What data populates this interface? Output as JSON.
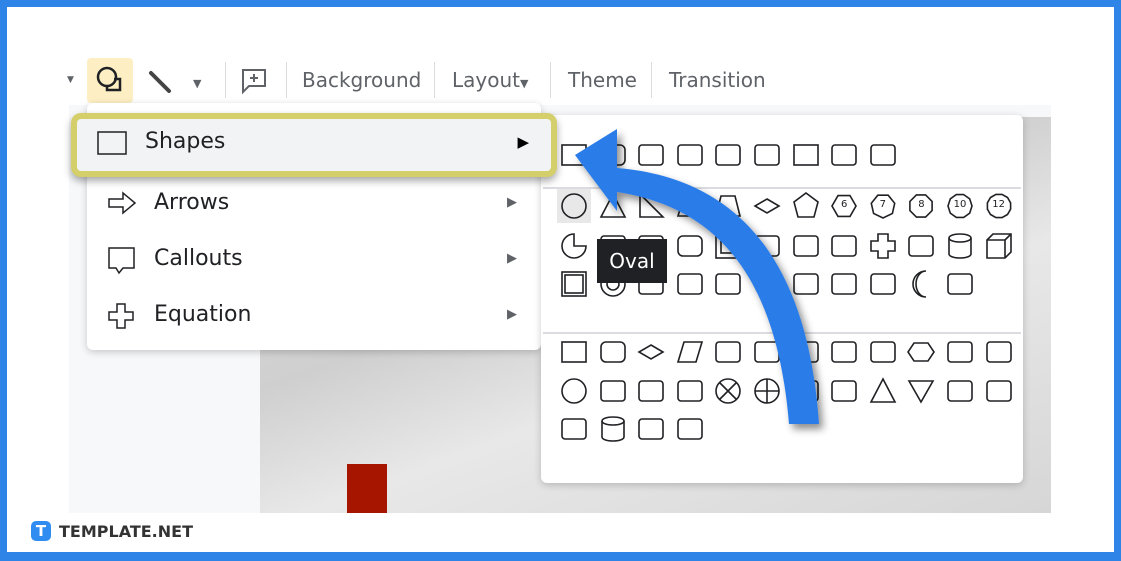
{
  "toolbar": {
    "background": "Background",
    "layout": "Layout",
    "theme": "Theme",
    "transition": "Transition"
  },
  "menu": {
    "items": [
      {
        "label": "Shapes",
        "icon": "square-icon"
      },
      {
        "label": "Arrows",
        "icon": "arrow-right-icon"
      },
      {
        "label": "Callouts",
        "icon": "callout-icon"
      },
      {
        "label": "Equation",
        "icon": "plus-icon"
      }
    ],
    "submenu_arrow": "▶"
  },
  "submenu": {
    "rows": [
      [
        "rect",
        "round-rect",
        "snip-rect",
        "round-top",
        "snip-corner",
        "round-top",
        "rect",
        "round-top",
        "round-corner"
      ],
      [
        "oval",
        "triangle",
        "right-triangle",
        "parallelogram",
        "trapezoid",
        "diamond",
        "pentagon",
        "hexagon-6",
        "heptagon-7",
        "octagon-8",
        "decagon-10",
        "dodecagon-12"
      ],
      [
        "pie",
        "chord",
        "teardrop",
        "round-rect",
        "frame",
        "half-frame",
        "l-shape",
        "diagonal-stripe",
        "cross",
        "octagon-plaque",
        "can",
        "cube"
      ],
      [
        "bevel",
        "donut",
        "no-symbol",
        "block-arc",
        "folded-corner",
        "smiley",
        "heart",
        "lightning",
        "sun",
        "moon",
        "cloud"
      ],
      [
        "rect",
        "round-rect",
        "diamond",
        "parallelogram",
        "predefined",
        "internal-storage",
        "document",
        "multidoc",
        "terminator",
        "hexagon",
        "manual-input",
        "manual-op"
      ],
      [
        "oval",
        "offpage",
        "card",
        "tape",
        "summing",
        "or",
        "collate",
        "sort",
        "triangle",
        "merge",
        "stored-data",
        "delay"
      ],
      [
        "seq-storage",
        "disk",
        "direct-storage",
        "display"
      ]
    ],
    "numbers": {
      "hexagon-6": "6",
      "heptagon-7": "7",
      "octagon-8": "8",
      "decagon-10": "10",
      "dodecagon-12": "12"
    }
  },
  "tooltip": "Oval",
  "logo": {
    "mark": "T",
    "name": "TEMPLATE.NET"
  },
  "colors": {
    "frame": "#2f84e8",
    "highlight": "#d4cf6a",
    "arrow": "#2b7de9"
  }
}
